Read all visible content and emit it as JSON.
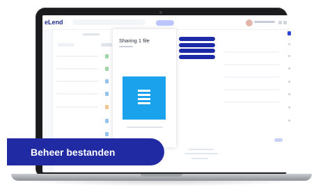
{
  "app": {
    "logo_text": "eLend",
    "search": {
      "placeholder": ""
    },
    "user": {
      "avatar": "avatar"
    }
  },
  "share_modal": {
    "title": "Sharing 1 file",
    "preview_icon": "document-icon",
    "options": [
      {
        "label": ""
      },
      {
        "label": ""
      },
      {
        "label": ""
      },
      {
        "label": ""
      }
    ]
  },
  "banner": {
    "text": "Beheer bestanden"
  },
  "colors": {
    "brand": "#1f2aa3",
    "preview": "#1aa2ec",
    "accent_light": "#bcc5ff"
  }
}
